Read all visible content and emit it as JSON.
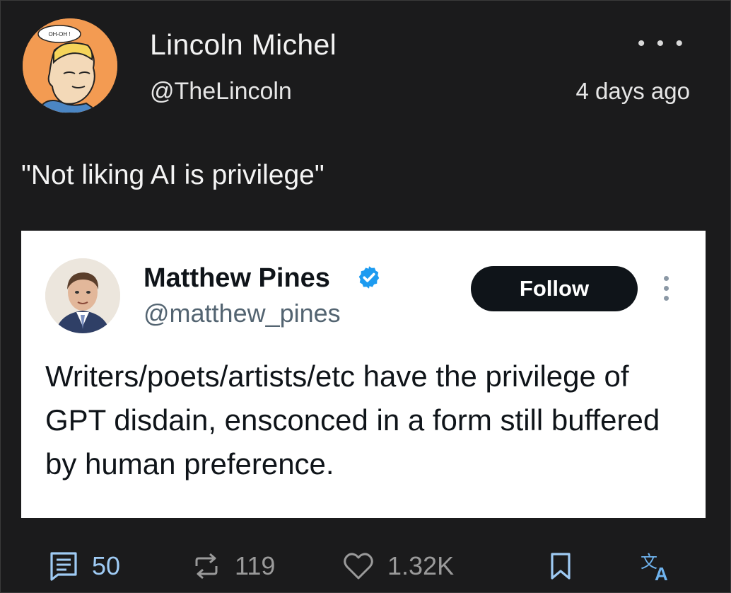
{
  "post": {
    "author_name": "Lincoln Michel",
    "author_handle": "@TheLincoln",
    "time": "4 days ago",
    "more": "• • •",
    "text": "\"Not liking AI is privilege\"",
    "avatar_caption": "OH-OH !"
  },
  "embed": {
    "name": "Matthew Pines",
    "handle": "@matthew_pines",
    "follow_label": "Follow",
    "text": "Writers/poets/artists/etc have the privilege of GPT disdain, ensconced in a form still buffered by human preference."
  },
  "actions": {
    "replies": "50",
    "reposts": "119",
    "likes": "1.32K"
  },
  "icons": {
    "reply": "comment-icon",
    "repost": "repost-icon",
    "like": "heart-icon",
    "bookmark": "bookmark-icon",
    "translate": "translate-icon",
    "verified": "verified-badge-icon",
    "more": "more-icon"
  },
  "colors": {
    "background": "#1b1b1c",
    "accent": "#9fcbf4",
    "verified": "#1d9bf0",
    "follow_bg": "#0f1419"
  }
}
